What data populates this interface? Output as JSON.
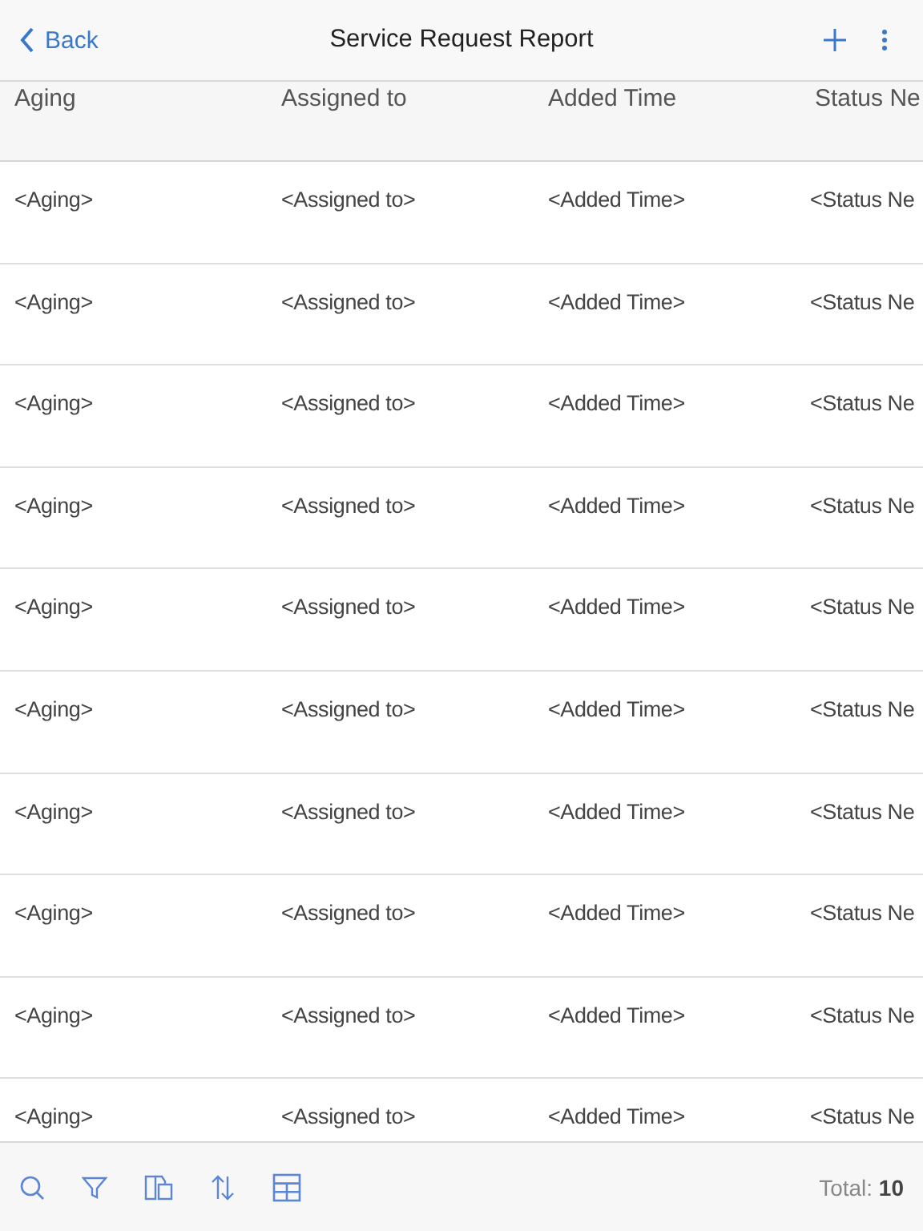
{
  "header": {
    "back": "Back",
    "title": "Service Request Report"
  },
  "table": {
    "columns": [
      "Aging",
      "Assigned to",
      "Added Time",
      "Status Ne"
    ],
    "rows": [
      [
        "<Aging>",
        "<Assigned to>",
        "<Added Time>",
        "<Status Ne"
      ],
      [
        "<Aging>",
        "<Assigned to>",
        "<Added Time>",
        "<Status Ne"
      ],
      [
        "<Aging>",
        "<Assigned to>",
        "<Added Time>",
        "<Status Ne"
      ],
      [
        "<Aging>",
        "<Assigned to>",
        "<Added Time>",
        "<Status Ne"
      ],
      [
        "<Aging>",
        "<Assigned to>",
        "<Added Time>",
        "<Status Ne"
      ],
      [
        "<Aging>",
        "<Assigned to>",
        "<Added Time>",
        "<Status Ne"
      ],
      [
        "<Aging>",
        "<Assigned to>",
        "<Added Time>",
        "<Status Ne"
      ],
      [
        "<Aging>",
        "<Assigned to>",
        "<Added Time>",
        "<Status Ne"
      ],
      [
        "<Aging>",
        "<Assigned to>",
        "<Added Time>",
        "<Status Ne"
      ],
      [
        "<Aging>",
        "<Assigned to>",
        "<Added Time>",
        "<Status Ne"
      ]
    ]
  },
  "footer": {
    "total": "Total: **10**"
  }
}
